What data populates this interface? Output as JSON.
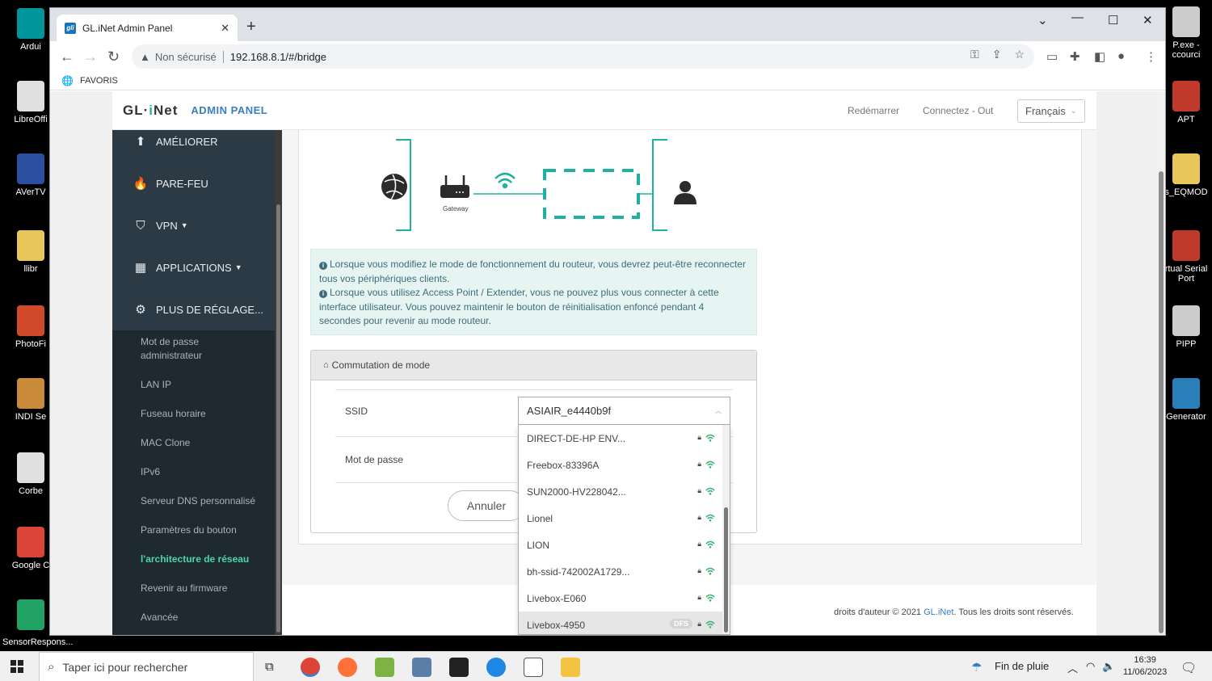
{
  "desktop": {
    "left_icons": [
      {
        "label": "Ardui",
        "color": "#00979c"
      },
      {
        "label": "LibreOffi",
        "color": "#e0e0e0"
      },
      {
        "label": "AVerTV",
        "color": "#2a4fa0"
      },
      {
        "label": "llibr",
        "color": "#e8c65a"
      },
      {
        "label": "PhotoFi",
        "color": "#d04a2a"
      },
      {
        "label": "INDI Se",
        "color": "#c98a3a"
      },
      {
        "label": "Corbe",
        "color": "#e0e0e0"
      },
      {
        "label": "Google C",
        "color": "#db4437"
      },
      {
        "label": "SensorRespons...",
        "color": "#21a366"
      }
    ],
    "right_icons": [
      {
        "label": "P.exe -\nccourci",
        "color": "#cccccc"
      },
      {
        "label": "APT",
        "color": "#c0392b"
      },
      {
        "label": "s_EQMOD",
        "color": "#e8c65a"
      },
      {
        "label": "rtual Serial\nPort",
        "color": "#c0392b"
      },
      {
        "label": "PIPP",
        "color": "#cccccc"
      },
      {
        "label": "Generator",
        "color": "#2980b9"
      }
    ]
  },
  "browser": {
    "tab_title": "GL.iNet Admin Panel",
    "favicon_text": "gli",
    "insecure_label": "Non sécurisé",
    "url": "192.168.8.1/#/bridge",
    "bookmark_label": "FAVORIS"
  },
  "admin": {
    "logo": "GL·iNet",
    "panel_label": "ADMIN PANEL",
    "nav": {
      "reboot": "Redémarrer",
      "logout": "Connectez - Out",
      "language": "Français"
    },
    "sidebar_sections": [
      {
        "label": "AMÉLIORER",
        "icon": "upgrade-icon",
        "glyph": "⬆",
        "dropdown": false
      },
      {
        "label": "PARE-FEU",
        "icon": "firewall-icon",
        "glyph": "🔥",
        "dropdown": false
      },
      {
        "label": "VPN",
        "icon": "shield-icon",
        "glyph": "⛉",
        "dropdown": true
      },
      {
        "label": "APPLICATIONS",
        "icon": "apps-icon",
        "glyph": "▦",
        "dropdown": true
      },
      {
        "label": "PLUS DE RÉGLAGE...",
        "icon": "gear-icon",
        "glyph": "⚙",
        "dropdown": false
      }
    ],
    "submenu": [
      "Mot de passe administrateur",
      "LAN IP",
      "Fuseau horaire",
      "MAC Clone",
      "IPv6",
      "Serveur DNS personnalisé",
      "Paramètres du bouton",
      "l'architecture de réseau",
      "Revenir au firmware",
      "Avancée"
    ],
    "active_submenu_index": 7,
    "diagram": {
      "gateway_label": "Gateway"
    },
    "alert": {
      "line1": "Lorsque vous modifiez le mode de fonctionnement du routeur, vous devrez peut-être reconnecter tous vos périphériques clients.",
      "line2": "Lorsque vous utilisez Access Point / Extender, vous ne pouvez plus vous connecter à cette interface utilisateur. Vous pouvez maintenir le bouton de réinitialisation enfoncé pendant 4 secondes pour revenir au mode routeur."
    },
    "mode": {
      "title": "Commutation de mode",
      "ssid_label": "SSID",
      "password_label": "Mot de passe",
      "selected_ssid": "ASIAIR_e4440b9f",
      "cancel_label": "Annuler"
    },
    "networks": [
      {
        "ssid": "DIRECT-DE-HP ENV...",
        "dfs": false,
        "selected": false
      },
      {
        "ssid": "Freebox-83396A",
        "dfs": false,
        "selected": false
      },
      {
        "ssid": "SUN2000-HV228042...",
        "dfs": false,
        "selected": false
      },
      {
        "ssid": "Lionel",
        "dfs": false,
        "selected": false
      },
      {
        "ssid": "LION",
        "dfs": false,
        "selected": false
      },
      {
        "ssid": "bh-ssid-742002A1729...",
        "dfs": false,
        "selected": false
      },
      {
        "ssid": "Livebox-E060",
        "dfs": false,
        "selected": false
      },
      {
        "ssid": "Livebox-4950",
        "dfs": true,
        "selected": true
      }
    ],
    "dfs_label": "DFS",
    "footer": {
      "prefix": "droits d'auteur © 2021 ",
      "brand": "GL.iNet",
      "suffix": ". Tous les droits sont réservés."
    },
    "colors": {
      "accent": "#20b2a0",
      "link": "#3a7ebf",
      "active_menu": "#4cd6a8",
      "sidebar": "#2c3a45"
    }
  },
  "taskbar": {
    "search_placeholder": "Taper ici pour rechercher",
    "weather": "Fin de pluie",
    "time": "16:39",
    "date": "11/06/2023"
  }
}
